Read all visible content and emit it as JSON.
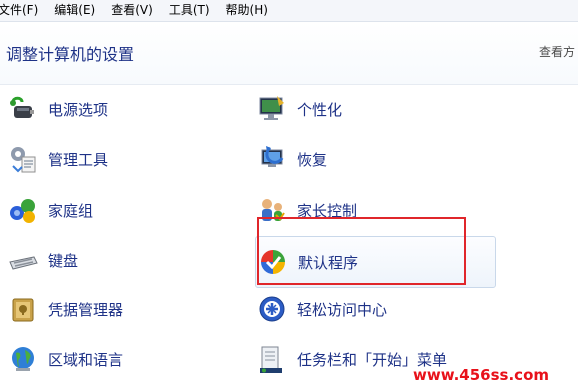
{
  "menubar": {
    "items": [
      {
        "label": "文件(F)"
      },
      {
        "label": "编辑(E)"
      },
      {
        "label": "查看(V)"
      },
      {
        "label": "工具(T)"
      },
      {
        "label": "帮助(H)"
      }
    ]
  },
  "header": {
    "title": "调整计算机的设置",
    "view_by": "查看方"
  },
  "items": [
    {
      "label": "电源选项",
      "icon": "power-options-icon"
    },
    {
      "label": "个性化",
      "icon": "personalization-icon"
    },
    {
      "label": "管理工具",
      "icon": "admin-tools-icon"
    },
    {
      "label": "恢复",
      "icon": "recovery-icon"
    },
    {
      "label": "家庭组",
      "icon": "homegroup-icon"
    },
    {
      "label": "家长控制",
      "icon": "parental-controls-icon"
    },
    {
      "label": "键盘",
      "icon": "keyboard-icon"
    },
    {
      "label": "默认程序",
      "icon": "default-programs-icon"
    },
    {
      "label": "凭据管理器",
      "icon": "credential-manager-icon"
    },
    {
      "label": "轻松访问中心",
      "icon": "ease-of-access-icon"
    },
    {
      "label": "区域和语言",
      "icon": "region-language-icon"
    },
    {
      "label": "任务栏和「开始」菜单",
      "icon": "taskbar-start-menu-icon"
    }
  ],
  "watermark": "www.456ss.com",
  "colors": {
    "link_text": "#1e3287",
    "highlight_box": "#e0262b",
    "watermark": "#e8111a"
  }
}
